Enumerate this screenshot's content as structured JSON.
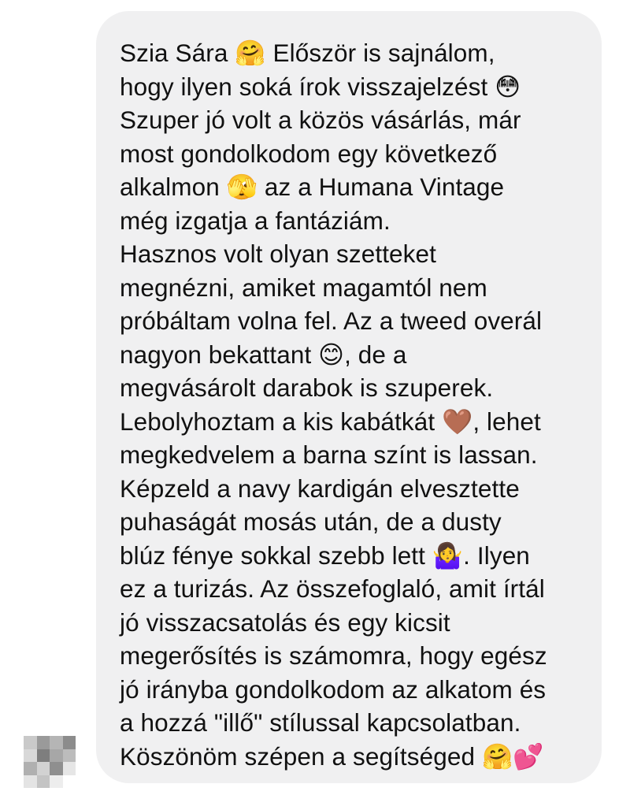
{
  "message": {
    "lines": [
      "Szia Sára 🤗 Először is sajnálom,",
      "hogy ilyen soká írok visszajelzést 😳",
      "Szuper jó volt a közös vásárlás, már",
      "most gondolkodom egy következő",
      "alkalmon 🫣 az a Humana Vintage",
      "még izgatja a fantáziám.",
      "Hasznos volt olyan szetteket",
      "megnézni, amiket magamtól nem",
      "próbáltam volna fel. Az a tweed overál",
      "nagyon bekattant 😊, de a",
      "megvásárolt darabok is szuperek.",
      "Lebolyhoztam a kis kabátkát 🤎, lehet",
      "megkedvelem a barna színt is lassan.",
      "Képzeld a navy kardigán elvesztette",
      "puhaságát mosás után, de a dusty",
      "blúz fénye sokkal szebb lett 🤷‍♀️. Ilyen",
      "ez a turizás. Az összefoglaló, amit írtál",
      "jó visszacsatolás és egy kicsit",
      "megerősítés is számomra, hogy egész",
      "jó irányba gondolkodom az alkatom és",
      "a hozzá \"illő\" stílussal kapcsolatban.",
      "Köszönöm szépen a segítséged 🤗💕"
    ]
  },
  "colors": {
    "bubble_background": "#f0f0f1",
    "text": "#111111",
    "avatar_pixels": [
      "#c9c9c9",
      "#9a9a9a",
      "#b5b5b5",
      "#8c8c8c",
      "#d8d8d8",
      "#7e7e7e",
      "#a7a7a7",
      "#bcbcbc",
      "#b0b0b0",
      "#d2d2d2",
      "#8f8f8f",
      "#e6e6e6",
      "#e4e4e4",
      "#c4c4c4",
      "#ededed",
      "#ffffff"
    ]
  }
}
